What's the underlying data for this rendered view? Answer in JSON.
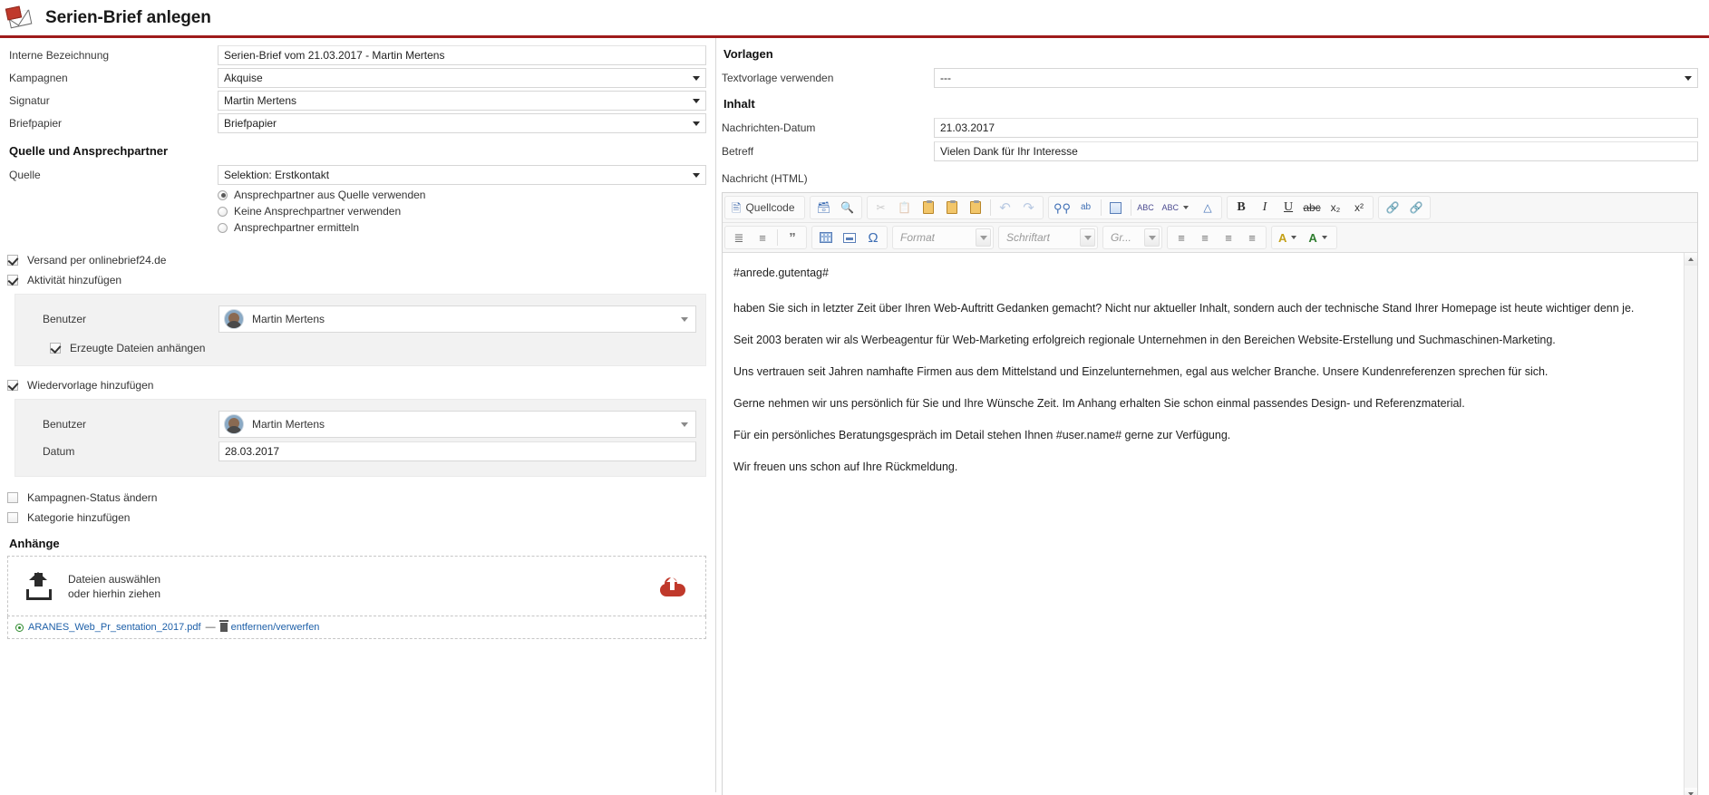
{
  "header": {
    "title": "Serien-Brief anlegen",
    "icon": "letter-stamp-icon"
  },
  "left": {
    "fields": [
      {
        "label": "Interne Bezeichnung",
        "value": "Serien-Brief vom 21.03.2017 - Martin Mertens",
        "type": "text"
      },
      {
        "label": "Kampagnen",
        "value": "Akquise",
        "type": "select"
      },
      {
        "label": "Signatur",
        "value": "Martin Mertens",
        "type": "select"
      },
      {
        "label": "Briefpapier",
        "value": "Briefpapier",
        "type": "select"
      }
    ],
    "source_section": {
      "heading": "Quelle und Ansprechpartner",
      "quelle_label": "Quelle",
      "quelle_value": "Selektion: Erstkontakt",
      "radios": [
        {
          "label": "Ansprechpartner aus Quelle verwenden",
          "checked": true
        },
        {
          "label": "Keine Ansprechpartner verwenden",
          "checked": false
        },
        {
          "label": "Ansprechpartner ermitteln",
          "checked": false
        }
      ]
    },
    "options": {
      "versand": {
        "label": "Versand per onlinebrief24.de",
        "checked": true
      },
      "aktivitaet": {
        "label": "Aktivität hinzufügen",
        "checked": true
      },
      "aktivitaet_panel": {
        "benutzer_label": "Benutzer",
        "benutzer_value": "Martin Mertens",
        "attach_label": "Erzeugte Dateien anhängen",
        "attach_checked": true
      },
      "wiedervorlage": {
        "label": "Wiedervorlage hinzufügen",
        "checked": true
      },
      "wiedervorlage_panel": {
        "benutzer_label": "Benutzer",
        "benutzer_value": "Martin Mertens",
        "datum_label": "Datum",
        "datum_value": "28.03.2017"
      },
      "kampagnen_status": {
        "label": "Kampagnen-Status ändern",
        "checked": false
      },
      "kategorie": {
        "label": "Kategorie hinzufügen",
        "checked": false
      }
    },
    "attachments": {
      "heading": "Anhänge",
      "dropzone_line1": "Dateien auswählen",
      "dropzone_line2": "oder hierhin ziehen",
      "files": [
        {
          "name": "ARANES_Web_Pr_sentation_2017.pdf",
          "separator": "—",
          "remove_label": "entfernen/verwerfen"
        }
      ]
    }
  },
  "right": {
    "templates": {
      "heading": "Vorlagen",
      "label": "Textvorlage verwenden",
      "value": "---"
    },
    "content": {
      "heading": "Inhalt",
      "date_label": "Nachrichten-Datum",
      "date_value": "21.03.2017",
      "subject_label": "Betreff",
      "subject_value": "Vielen Dank für Ihr Interesse",
      "message_label": "Nachricht (HTML)"
    },
    "editor": {
      "toolbar_row1": [
        {
          "name": "source-code-button",
          "label": "Quellcode",
          "icon": "source-code-icon",
          "disabled": false
        },
        {
          "name": "save-button",
          "label": "",
          "icon": "save-icon",
          "disabled": false
        },
        {
          "name": "preview-button",
          "label": "",
          "icon": "preview-icon",
          "disabled": false
        },
        {
          "name": "cut-button",
          "label": "",
          "icon": "scissors-icon",
          "disabled": true
        },
        {
          "name": "copy-button",
          "label": "",
          "icon": "copy-icon",
          "disabled": true
        },
        {
          "name": "paste-button",
          "label": "",
          "icon": "paste-icon",
          "disabled": false
        },
        {
          "name": "paste-text-button",
          "label": "",
          "icon": "paste-text-icon",
          "disabled": false
        },
        {
          "name": "paste-word-button",
          "label": "",
          "icon": "paste-word-icon",
          "disabled": false
        },
        {
          "name": "undo-button",
          "label": "",
          "icon": "undo-arrow-icon",
          "disabled": true
        },
        {
          "name": "redo-button",
          "label": "",
          "icon": "redo-arrow-icon",
          "disabled": true
        },
        {
          "name": "find-button",
          "label": "",
          "icon": "binoculars-icon",
          "disabled": false
        },
        {
          "name": "replace-button",
          "label": "",
          "icon": "replace-icon",
          "disabled": false
        },
        {
          "name": "select-all-button",
          "label": "",
          "icon": "select-all-icon",
          "disabled": false
        },
        {
          "name": "spellcheck-button",
          "label": "",
          "icon": "spellcheck-icon",
          "disabled": false
        },
        {
          "name": "spellcheck-options-button",
          "label": "",
          "icon": "spellcheck-dropdown-icon",
          "disabled": false
        },
        {
          "name": "remove-format-button",
          "label": "",
          "icon": "eraser-icon",
          "disabled": false
        },
        {
          "name": "bold-button",
          "label": "B",
          "icon": "bold-icon",
          "disabled": false
        },
        {
          "name": "italic-button",
          "label": "I",
          "icon": "italic-icon",
          "disabled": false
        },
        {
          "name": "underline-button",
          "label": "U",
          "icon": "underline-icon",
          "disabled": false
        },
        {
          "name": "strike-button",
          "label": "abc",
          "icon": "strikethrough-icon",
          "disabled": false
        },
        {
          "name": "subscript-button",
          "label": "x₂",
          "icon": "subscript-icon",
          "disabled": false
        },
        {
          "name": "superscript-button",
          "label": "x²",
          "icon": "superscript-icon",
          "disabled": false
        },
        {
          "name": "link-button",
          "label": "",
          "icon": "link-icon",
          "disabled": false
        },
        {
          "name": "unlink-button",
          "label": "",
          "icon": "unlink-icon",
          "disabled": false
        }
      ],
      "toolbar_row2": [
        {
          "name": "numbered-list-button",
          "icon": "numbered-list-icon"
        },
        {
          "name": "bulleted-list-button",
          "icon": "bulleted-list-icon"
        },
        {
          "name": "blockquote-button",
          "icon": "blockquote-icon"
        },
        {
          "name": "table-button",
          "icon": "table-icon"
        },
        {
          "name": "horizontal-rule-button",
          "icon": "horizontal-rule-icon"
        },
        {
          "name": "special-char-button",
          "icon": "omega-icon"
        },
        {
          "name": "align-left-button",
          "icon": "align-left-icon"
        },
        {
          "name": "align-center-button",
          "icon": "align-center-icon"
        },
        {
          "name": "align-right-button",
          "icon": "align-right-icon"
        },
        {
          "name": "align-justify-button",
          "icon": "align-justify-icon"
        },
        {
          "name": "text-color-button",
          "icon": "text-color-icon"
        },
        {
          "name": "bg-color-button",
          "icon": "background-color-icon"
        }
      ],
      "combos": [
        {
          "name": "format-select",
          "placeholder": "Format"
        },
        {
          "name": "font-select",
          "placeholder": "Schriftart"
        },
        {
          "name": "size-select",
          "placeholder": "Gr..."
        }
      ],
      "body_paragraphs": [
        "#anrede.gutentag#",
        "haben Sie sich in letzter Zeit über Ihren Web-Auftritt Gedanken gemacht? Nicht nur aktueller Inhalt, sondern auch der technische Stand Ihrer Homepage ist heute wichtiger denn je.",
        "Seit 2003 beraten wir als Werbeagentur für Web-Marketing erfolgreich regionale Unternehmen in den Bereichen Website-Erstellung und Suchmaschinen-Marketing.",
        "Uns vertrauen seit Jahren namhafte Firmen aus dem Mittelstand und Einzelunternehmen, egal aus welcher Branche. Unsere Kundenreferenzen sprechen für sich.",
        "Gerne nehmen wir uns persönlich für Sie und Ihre Wünsche Zeit. Im Anhang erhalten Sie schon einmal passendes Design- und Referenzmaterial.",
        "Für ein persönliches Beratungsgespräch im Detail stehen Ihnen #user.name# gerne zur Verfügung.",
        "Wir freuen uns schon auf Ihre Rückmeldung."
      ]
    }
  },
  "colors": {
    "accent": "#9e1b1b",
    "link": "#1d5fa8",
    "panel_bg": "#f2f2f2",
    "toolbar_bg": "#f7f7f7"
  }
}
